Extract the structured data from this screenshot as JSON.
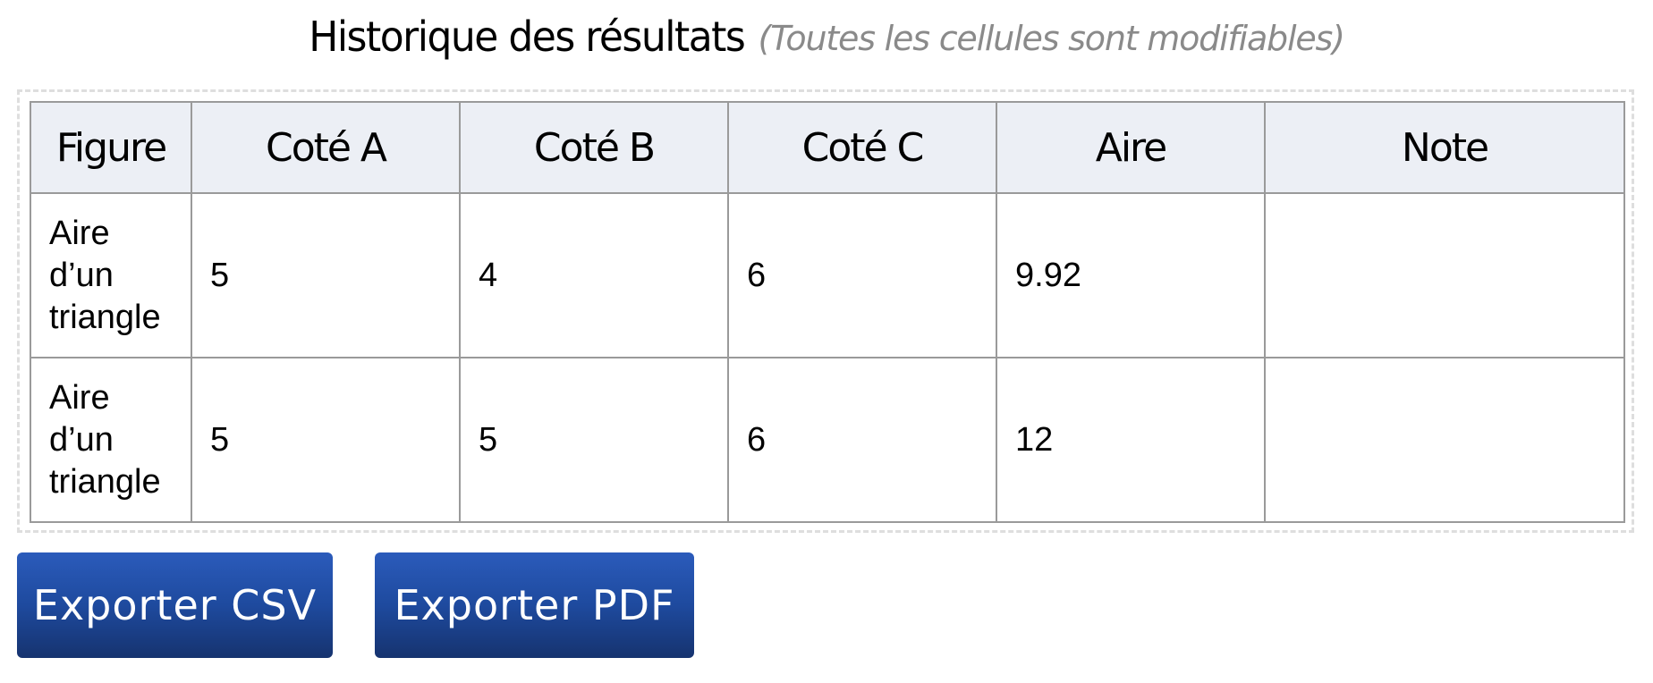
{
  "header": {
    "title": "Historique des résultats",
    "note": "(Toutes les cellules sont modifiables)"
  },
  "table": {
    "columns": [
      "Figure",
      "Coté A",
      "Coté B",
      "Coté C",
      "Aire",
      "Note"
    ],
    "rows": [
      [
        "Aire d’un triangle",
        "5",
        "4",
        "6",
        "9.92",
        ""
      ],
      [
        "Aire d’un triangle",
        "5",
        "5",
        "6",
        "12",
        ""
      ]
    ]
  },
  "actions": {
    "export_csv": "Exporter CSV",
    "export_pdf": "Exporter PDF"
  },
  "colors": {
    "header_bg": "#eceff5",
    "button_top": "#2b5bbb",
    "button_bottom": "#16336f",
    "note_text": "#8a8a8a"
  }
}
